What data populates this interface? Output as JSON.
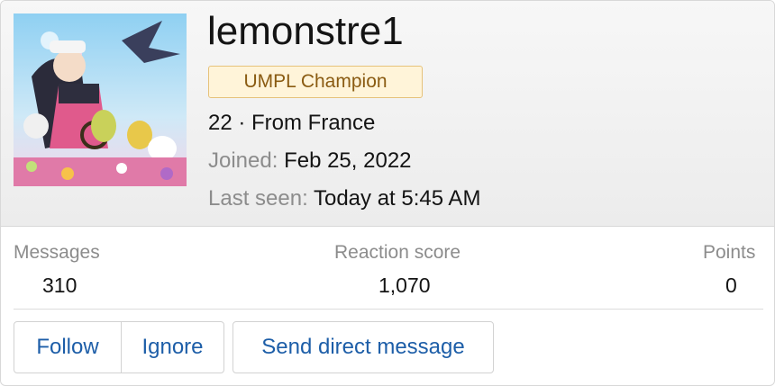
{
  "profile": {
    "username": "lemonstre1",
    "badge": "UMPL Champion",
    "age_location": "22 · From France",
    "joined_label": "Joined:",
    "joined_value": "Feb 25, 2022",
    "last_seen_label": "Last seen:",
    "last_seen_value": "Today at 5:45 AM",
    "avatar_icon": "avatar-image"
  },
  "stats": [
    {
      "label": "Messages",
      "value": "310"
    },
    {
      "label": "Reaction score",
      "value": "1,070"
    },
    {
      "label": "Points",
      "value": "0"
    }
  ],
  "actions": {
    "follow": "Follow",
    "ignore": "Ignore",
    "message": "Send direct message"
  },
  "colors": {
    "link": "#1d5ea8",
    "badge_bg": "#fff4d9",
    "badge_border": "#e6c27a",
    "badge_text": "#8a5b12",
    "muted": "#8c8c8c"
  }
}
